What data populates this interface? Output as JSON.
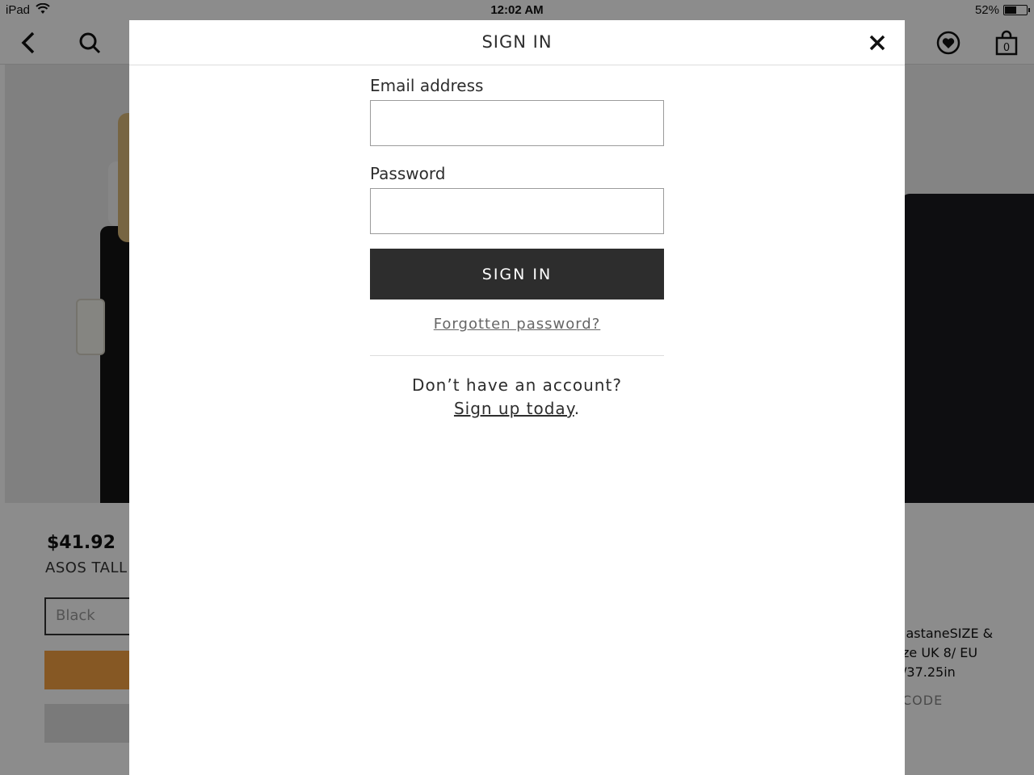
{
  "status_bar": {
    "device": "iPad",
    "time": "12:02 AM",
    "battery": "52%",
    "battery_level": 0.52
  },
  "nav": {
    "back_icon": "chevron-left-icon",
    "search_icon": "search-icon",
    "wishlist_icon": "heart-icon",
    "bag_icon": "shopping-bag-icon",
    "bag_count": "0"
  },
  "product": {
    "price": "$41.92",
    "name": "ASOS TALL T",
    "colour": "Black",
    "details": [
      "lastaneSIZE &",
      "ze UK 8/ EU",
      "/37.25in"
    ],
    "code_label": "CODE"
  },
  "modal": {
    "title": "SIGN IN",
    "close_icon": "close-icon",
    "email_label": "Email address",
    "email_value": "",
    "password_label": "Password",
    "password_value": "",
    "submit_label": "SIGN IN",
    "forgot_label": "Forgotten password?",
    "signup_prompt": "Don’t have an account?",
    "signup_link": "Sign up today",
    "signup_suffix": "."
  },
  "colors": {
    "button_dark": "#2d2d2d",
    "text": "#2d2d2d",
    "add_to_bag": "#f5a043",
    "overlay": "rgba(0,0,0,0.45)"
  }
}
